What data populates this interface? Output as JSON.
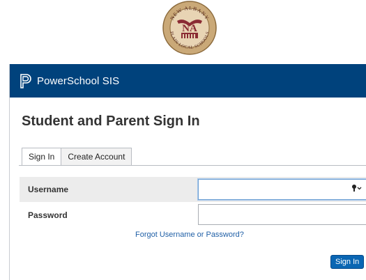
{
  "logo": {
    "top_text": "NEW ALBANY",
    "bottom_text": "PLAIN LOCAL SCHOOLS",
    "monogram": "NA",
    "colors": {
      "ring": "#caa978",
      "inner": "#8a2b33",
      "cream": "#e8d4b4"
    }
  },
  "header": {
    "brand": "PowerSchool SIS",
    "icon": "powerschool-logo-icon",
    "bg": "#00427c"
  },
  "page_title": "Student and Parent Sign In",
  "tabs": [
    {
      "label": "Sign In",
      "active": true
    },
    {
      "label": "Create Account",
      "active": false
    }
  ],
  "form": {
    "username_label": "Username",
    "username_value": "",
    "password_label": "Password",
    "password_value": "",
    "forgot_link": "Forgot Username or Password?",
    "submit_label": "Sign In",
    "key_icon": "password-key-icon"
  },
  "colors": {
    "link": "#1f5fa6",
    "button": "#0a66b3"
  }
}
